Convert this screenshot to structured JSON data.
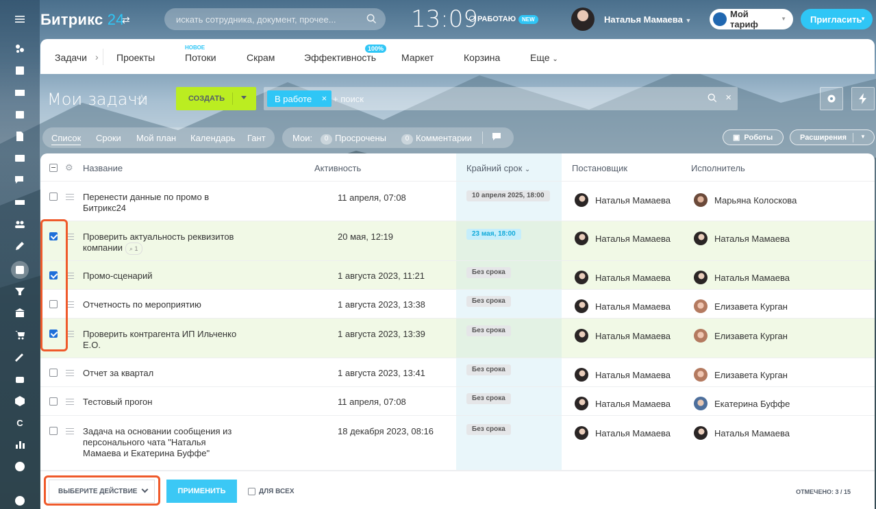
{
  "header": {
    "logo_main": "Битрикс",
    "logo_num": "24",
    "search_placeholder": "искать сотрудника, документ, прочее...",
    "clock": "13:09",
    "work_status": "РАБОТАЮ",
    "new_badge": "NEW",
    "user_name": "Наталья Мамаева",
    "plan_label": "Мой тариф",
    "invite_label": "Пригласить"
  },
  "nav": {
    "items": [
      "Задачи",
      "Проекты",
      "Потоки",
      "Скрам",
      "Эффективность",
      "Маркет",
      "Корзина",
      "Еще"
    ],
    "new_label": "НОВОЕ",
    "pct_label": "100%"
  },
  "toolbar": {
    "title": "Мои задачи",
    "create_label": "СОЗДАТЬ",
    "filter_chip": "В работе",
    "filter_placeholder": "+ поиск"
  },
  "views": {
    "tabs": [
      "Список",
      "Сроки",
      "Мой план",
      "Календарь",
      "Гант"
    ],
    "my_label": "Мои:",
    "overdue_count": "0",
    "overdue_label": "Просрочены",
    "comments_count": "0",
    "comments_label": "Комментарии",
    "robots_label": "Роботы",
    "ext_label": "Расширения"
  },
  "table": {
    "columns": [
      "Название",
      "Активность",
      "Крайний срок",
      "Постановщик",
      "Исполнитель"
    ],
    "rows": [
      {
        "name": "Перенести данные по промо в Битрикс24",
        "activity": "11 апреля, 07:08",
        "deadline": "10 апреля 2025, 18:00",
        "creator": "Наталья Мамаева",
        "assignee": "Марьяна Колоскова",
        "checked": false
      },
      {
        "name": "Проверить актуальность реквизитов компании",
        "clip": "1",
        "activity": "20 мая, 12:19",
        "deadline": "23 мая, 18:00",
        "creator": "Наталья Мамаева",
        "assignee": "Наталья Мамаева",
        "checked": true
      },
      {
        "name": "Промо-сценарий",
        "activity": "1 августа 2023, 11:21",
        "deadline": "Без срока",
        "creator": "Наталья Мамаева",
        "assignee": "Наталья Мамаева",
        "checked": true
      },
      {
        "name": "Отчетность по мероприятию",
        "activity": "1 августа 2023, 13:38",
        "deadline": "Без срока",
        "creator": "Наталья Мамаева",
        "assignee": "Елизавета Курган",
        "checked": false
      },
      {
        "name": "Проверить контрагента ИП Ильченко Е.О.",
        "activity": "1 августа 2023, 13:39",
        "deadline": "Без срока",
        "creator": "Наталья Мамаева",
        "assignee": "Елизавета Курган",
        "checked": true
      },
      {
        "name": "Отчет за квартал",
        "activity": "1 августа 2023, 13:41",
        "deadline": "Без срока",
        "creator": "Наталья Мамаева",
        "assignee": "Елизавета Курган",
        "checked": false
      },
      {
        "name": "Тестовый прогон",
        "activity": "11 апреля, 07:08",
        "deadline": "Без срока",
        "creator": "Наталья Мамаева",
        "assignee": "Екатерина Буффе",
        "checked": false
      },
      {
        "name": "Задача на основании сообщения из персонального чата \"Наталья Мамаева и Екатерина Буффе\"",
        "activity": "18 декабря 2023, 08:16",
        "deadline": "Без срока",
        "creator": "Наталья Мамаева",
        "assignee": "Наталья Мамаева",
        "checked": false
      }
    ]
  },
  "footer": {
    "action_select": "ВЫБЕРИТЕ ДЕЙСТВИЕ",
    "apply_label": "ПРИМЕНИТЬ",
    "for_all_label": "ДЛЯ ВСЕХ",
    "marked_label": "ОТМЕЧЕНО:",
    "marked_value": "3 / 15"
  },
  "left_icons": [
    "menu-icon",
    "feed-icon",
    "notes-icon",
    "mail-icon",
    "calendar-icon",
    "document-icon",
    "contacts-icon",
    "chat-icon",
    "inbox-icon",
    "users-icon",
    "edit-icon",
    "tasks-icon",
    "filter-icon",
    "bank-icon",
    "cart-icon",
    "sign-icon",
    "robot-icon",
    "box-icon",
    "c-icon",
    "analytics-icon",
    "more-icon",
    "help-icon"
  ],
  "colors": {
    "accent": "#2fc6f6",
    "create": "#bbed21",
    "highlight": "#ef5a2b",
    "checkbox": "#1e6fd9"
  }
}
